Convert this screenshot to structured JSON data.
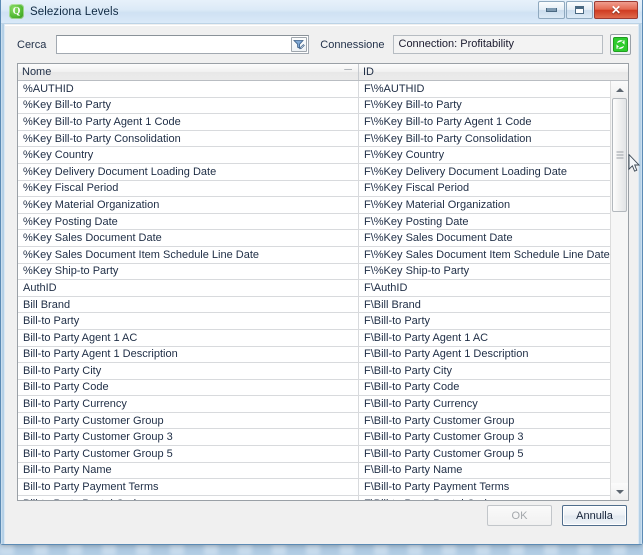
{
  "window": {
    "title": "Seleziona Levels",
    "app_icon": "quality-center-icon",
    "app_icon_glyph": "Q",
    "controls": {
      "minimize_label": "Riduci a icona",
      "maximize_label": "Ingrandisci",
      "close_label": "Chiudi",
      "close_glyph": "✕"
    },
    "accent_color": "#4eb730",
    "titlebar_color": "#dceaf7",
    "close_color": "#cf3b21"
  },
  "toolbar": {
    "search_label": "Cerca",
    "search_value": "",
    "search_placeholder": "",
    "filter_icon": "filter-edit-icon",
    "connection_label": "Connessione",
    "connection_value": "Connection: Profitability",
    "refresh_icon": "refresh-icon",
    "refresh_color": "#3fd43f"
  },
  "grid": {
    "columns": [
      {
        "key": "name",
        "header": "Nome",
        "sort": "ascending",
        "sort_icon": "sort-ascending-icon"
      },
      {
        "key": "id",
        "header": "ID",
        "sort": "none"
      }
    ],
    "rows": [
      {
        "name": "%AUTHID",
        "id": "F\\%AUTHID"
      },
      {
        "name": "%Key Bill-to Party",
        "id": "F\\%Key Bill-to Party"
      },
      {
        "name": "%Key Bill-to Party Agent 1 Code",
        "id": "F\\%Key Bill-to Party Agent 1 Code"
      },
      {
        "name": "%Key Bill-to Party Consolidation",
        "id": "F\\%Key Bill-to Party Consolidation"
      },
      {
        "name": "%Key Country",
        "id": "F\\%Key Country"
      },
      {
        "name": "%Key Delivery Document Loading Date",
        "id": "F\\%Key Delivery Document Loading Date"
      },
      {
        "name": "%Key Fiscal Period",
        "id": "F\\%Key Fiscal Period"
      },
      {
        "name": "%Key Material Organization",
        "id": "F\\%Key Material Organization"
      },
      {
        "name": "%Key Posting Date",
        "id": "F\\%Key Posting Date"
      },
      {
        "name": "%Key Sales Document Date",
        "id": "F\\%Key Sales Document Date"
      },
      {
        "name": "%Key Sales Document Item Schedule Line Date",
        "id": "F\\%Key Sales Document Item Schedule Line Date"
      },
      {
        "name": "%Key Ship-to Party",
        "id": "F\\%Key Ship-to Party"
      },
      {
        "name": "AuthID",
        "id": "F\\AuthID"
      },
      {
        "name": "Bill Brand",
        "id": "F\\Bill Brand"
      },
      {
        "name": "Bill-to Party",
        "id": "F\\Bill-to Party"
      },
      {
        "name": "Bill-to Party Agent 1 AC",
        "id": "F\\Bill-to Party Agent 1 AC"
      },
      {
        "name": "Bill-to Party Agent 1 Description",
        "id": "F\\Bill-to Party Agent 1 Description"
      },
      {
        "name": "Bill-to Party City",
        "id": "F\\Bill-to Party City"
      },
      {
        "name": "Bill-to Party Code",
        "id": "F\\Bill-to Party Code"
      },
      {
        "name": "Bill-to Party Currency",
        "id": "F\\Bill-to Party Currency"
      },
      {
        "name": "Bill-to Party Customer Group",
        "id": "F\\Bill-to Party Customer Group"
      },
      {
        "name": "Bill-to Party Customer Group 3",
        "id": "F\\Bill-to Party Customer Group 3"
      },
      {
        "name": "Bill-to Party Customer Group 5",
        "id": "F\\Bill-to Party Customer Group 5"
      },
      {
        "name": "Bill-to Party Name",
        "id": "F\\Bill-to Party Name"
      },
      {
        "name": "Bill-to Party Payment Terms",
        "id": "F\\Bill-to Party Payment Terms"
      },
      {
        "name": "Bill-to Party Postal Code",
        "id": "F\\Bill-to Party Postal Code"
      }
    ],
    "scrollbar": {
      "orientation": "vertical",
      "thumb_position": "near-top",
      "up_arrow": "scroll-up-arrow-icon",
      "down_arrow": "scroll-down-arrow-icon"
    }
  },
  "footer": {
    "ok_label": "OK",
    "ok_enabled": false,
    "cancel_label": "Annulla",
    "cancel_enabled": true
  }
}
